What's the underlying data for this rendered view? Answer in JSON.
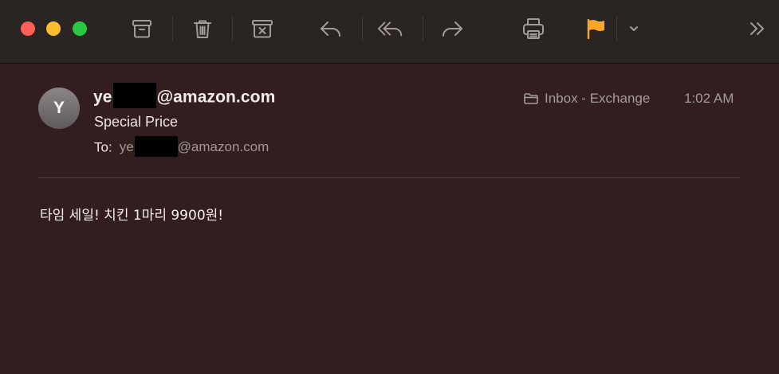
{
  "toolbar": {
    "buttons": [
      {
        "name": "archive-icon"
      },
      {
        "name": "trash-icon"
      },
      {
        "name": "junk-icon"
      },
      {
        "name": "reply-icon"
      },
      {
        "name": "reply-all-icon"
      },
      {
        "name": "forward-icon"
      },
      {
        "name": "print-icon"
      },
      {
        "name": "flag-icon"
      },
      {
        "name": "chevron-down-icon"
      },
      {
        "name": "more-toolbar-icon"
      }
    ],
    "flag_color": "#f9a62a",
    "overflow_label": "»"
  },
  "message": {
    "avatar_initial": "Y",
    "from_prefix": "ye",
    "from_suffix": "@amazon.com",
    "subject": "Special Price",
    "to_label": "To:",
    "to_prefix": "ye",
    "to_suffix": "@amazon.com",
    "mailbox": "Inbox - Exchange",
    "time": "1:02 AM",
    "body": "타임 세일! 치킨 1마리 9900원!"
  }
}
